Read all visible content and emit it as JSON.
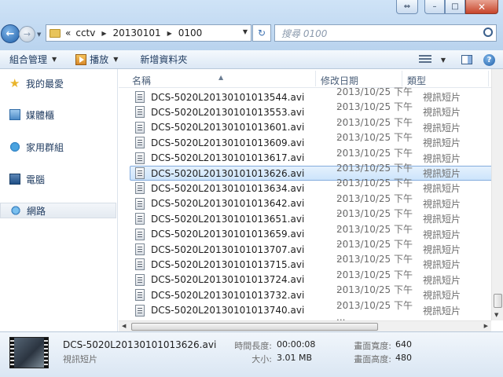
{
  "window": {
    "controls": {
      "extra": "⇔",
      "minimize": "–",
      "maximize": "□",
      "close": "✕"
    }
  },
  "nav": {
    "back": "←",
    "forward": "→",
    "recent": "▼"
  },
  "address": {
    "prefix": "«",
    "crumbs": [
      "cctv",
      "20130101",
      "0100"
    ],
    "sep": "▶",
    "dropdown": "▼",
    "refresh": "↻"
  },
  "search": {
    "placeholder": "搜尋 0100"
  },
  "toolbar": {
    "organize": "組合管理",
    "play": "播放",
    "new_folder": "新增資料夾",
    "arrow": "▼",
    "help": "?"
  },
  "sidebar": {
    "items": [
      {
        "label": "我的最愛",
        "icon": "star-icon"
      },
      {
        "label": "媒體櫃",
        "icon": "library-icon"
      },
      {
        "label": "家用群組",
        "icon": "homegroup-icon"
      },
      {
        "label": "電腦",
        "icon": "computer-icon"
      },
      {
        "label": "網路",
        "icon": "network-icon"
      }
    ]
  },
  "columns": {
    "name": "名稱",
    "date": "修改日期",
    "type": "類型",
    "sort": "▲"
  },
  "files": [
    {
      "name": "DCS-5020L20130101013544.avi",
      "date": "2013/10/25 下午 ...",
      "type": "視訊短片"
    },
    {
      "name": "DCS-5020L20130101013553.avi",
      "date": "2013/10/25 下午 ...",
      "type": "視訊短片"
    },
    {
      "name": "DCS-5020L20130101013601.avi",
      "date": "2013/10/25 下午 ...",
      "type": "視訊短片"
    },
    {
      "name": "DCS-5020L20130101013609.avi",
      "date": "2013/10/25 下午 ...",
      "type": "視訊短片"
    },
    {
      "name": "DCS-5020L20130101013617.avi",
      "date": "2013/10/25 下午 ...",
      "type": "視訊短片"
    },
    {
      "name": "DCS-5020L20130101013626.avi",
      "date": "2013/10/25 下午 ...",
      "type": "視訊短片",
      "selected": true
    },
    {
      "name": "DCS-5020L20130101013634.avi",
      "date": "2013/10/25 下午 ...",
      "type": "視訊短片"
    },
    {
      "name": "DCS-5020L20130101013642.avi",
      "date": "2013/10/25 下午 ...",
      "type": "視訊短片"
    },
    {
      "name": "DCS-5020L20130101013651.avi",
      "date": "2013/10/25 下午 ...",
      "type": "視訊短片"
    },
    {
      "name": "DCS-5020L20130101013659.avi",
      "date": "2013/10/25 下午 ...",
      "type": "視訊短片"
    },
    {
      "name": "DCS-5020L20130101013707.avi",
      "date": "2013/10/25 下午 ...",
      "type": "視訊短片"
    },
    {
      "name": "DCS-5020L20130101013715.avi",
      "date": "2013/10/25 下午 ...",
      "type": "視訊短片"
    },
    {
      "name": "DCS-5020L20130101013724.avi",
      "date": "2013/10/25 下午 ...",
      "type": "視訊短片"
    },
    {
      "name": "DCS-5020L20130101013732.avi",
      "date": "2013/10/25 下午 ...",
      "type": "視訊短片"
    },
    {
      "name": "DCS-5020L20130101013740.avi",
      "date": "2013/10/25 下午 ...",
      "type": "視訊短片"
    }
  ],
  "scroll": {
    "up": "▲",
    "down": "▼",
    "left": "◀",
    "right": "▶"
  },
  "details": {
    "name": "DCS-5020L20130101013626.avi",
    "type": "視訊短片",
    "length_label": "時間長度:",
    "length": "00:00:08",
    "size_label": "大小:",
    "size": "3.01 MB",
    "width_label": "畫面寬度:",
    "width": "640",
    "height_label": "畫面高度:",
    "height": "480"
  }
}
